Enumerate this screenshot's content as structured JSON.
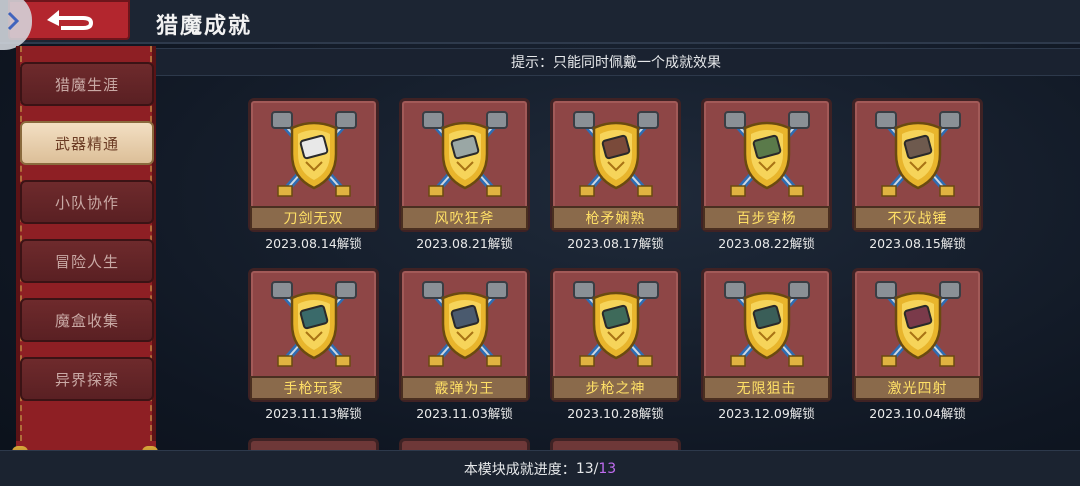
{
  "header": {
    "title": "猎魔成就",
    "back_icon": "back-arrow-icon",
    "corner_icon": "chevron-right-icon"
  },
  "hint": "提示：只能同时佩戴一个成就效果",
  "sidebar": {
    "items": [
      {
        "label": "猎魔生涯",
        "active": false
      },
      {
        "label": "武器精通",
        "active": true
      },
      {
        "label": "小队协作",
        "active": false
      },
      {
        "label": "冒险人生",
        "active": false
      },
      {
        "label": "魔盒收集",
        "active": false
      },
      {
        "label": "异界探索",
        "active": false
      }
    ]
  },
  "achievements": [
    {
      "name": "刀剑无双",
      "date": "2023.08.14解锁",
      "gem": "#e8e8e8"
    },
    {
      "name": "风吹狂斧",
      "date": "2023.08.21解锁",
      "gem": "#9aa7a5"
    },
    {
      "name": "枪矛娴熟",
      "date": "2023.08.17解锁",
      "gem": "#7a4a3a"
    },
    {
      "name": "百步穿杨",
      "date": "2023.08.22解锁",
      "gem": "#5a7a4a"
    },
    {
      "name": "不灭战锤",
      "date": "2023.08.15解锁",
      "gem": "#6e5a4e"
    },
    {
      "name": "手枪玩家",
      "date": "2023.11.13解锁",
      "gem": "#3a6a6a"
    },
    {
      "name": "霰弹为王",
      "date": "2023.11.03解锁",
      "gem": "#4a5a6e"
    },
    {
      "name": "步枪之神",
      "date": "2023.10.28解锁",
      "gem": "#3e6a5a"
    },
    {
      "name": "无限狙击",
      "date": "2023.12.09解锁",
      "gem": "#3a5e58"
    },
    {
      "name": "激光四射",
      "date": "2023.10.04解锁",
      "gem": "#7a3a4a"
    }
  ],
  "footer": {
    "label": "本模块成就进度：",
    "current": "13",
    "separator": "/",
    "total": "13"
  },
  "colors": {
    "accent": "#b3262e",
    "name_text": "#ffe066",
    "progress_total": "#c06cf0"
  }
}
